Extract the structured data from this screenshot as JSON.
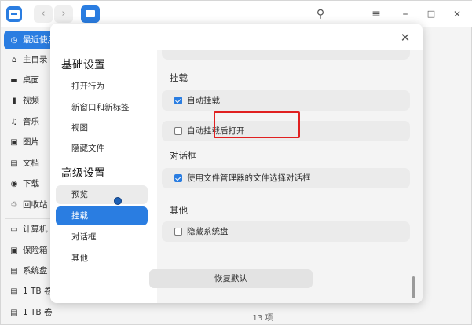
{
  "titlebar": {
    "back_icon": "‹",
    "forward_icon": "›",
    "search_icon": "⚲",
    "menu_icon": "≡",
    "minimize_icon": "–",
    "maximize_icon": "□",
    "close_icon": "✕"
  },
  "sidebar": {
    "items": [
      {
        "label": "最近使用",
        "icon": "◷"
      },
      {
        "label": "主目录",
        "icon": "⌂"
      },
      {
        "label": "桌面",
        "icon": "▬"
      },
      {
        "label": "视频",
        "icon": "▮"
      },
      {
        "label": "音乐",
        "icon": "♫"
      },
      {
        "label": "图片",
        "icon": "▣"
      },
      {
        "label": "文档",
        "icon": "▤"
      },
      {
        "label": "下载",
        "icon": "◉"
      },
      {
        "label": "回收站",
        "icon": "♲"
      },
      {
        "label": "计算机",
        "icon": "▭"
      },
      {
        "label": "保险箱",
        "icon": "▣"
      },
      {
        "label": "系统盘",
        "icon": "▤"
      },
      {
        "label": "1 TB 卷",
        "icon": "▤"
      },
      {
        "label": "1 TB 卷",
        "icon": "▤"
      }
    ]
  },
  "status": {
    "count_text": "13 项"
  },
  "dialog": {
    "close_icon": "✕",
    "nav": {
      "group_basic": "基础设置",
      "basic_items": [
        "打开行为",
        "新窗口和新标签",
        "视图",
        "隐藏文件"
      ],
      "group_advanced": "高级设置",
      "advanced_items": [
        "预览",
        "挂载",
        "对话框",
        "其他"
      ]
    },
    "sections": {
      "mount": {
        "title": "挂载",
        "auto_mount": "自动挂载",
        "auto_mount_open": "自动挂载后打开"
      },
      "dialog": {
        "title": "对话框",
        "use_fm_dialog": "使用文件管理器的文件选择对话框"
      },
      "other": {
        "title": "其他",
        "hide_system_disk": "隐藏系统盘"
      }
    },
    "reset_label": "恢复默认"
  },
  "colors": {
    "accent": "#2a7de1",
    "highlight_border": "#e02020",
    "desktop_background": "#2ab27b"
  }
}
